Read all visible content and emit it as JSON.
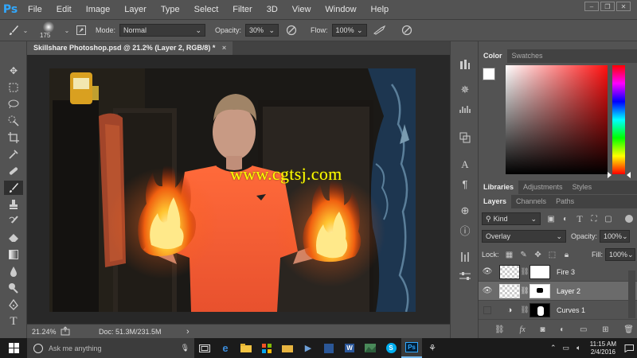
{
  "app": {
    "logo": "Ps"
  },
  "menu": [
    "File",
    "Edit",
    "Image",
    "Layer",
    "Type",
    "Select",
    "Filter",
    "3D",
    "View",
    "Window",
    "Help"
  ],
  "window_controls": {
    "minimize": "–",
    "restore": "❐",
    "close": "✕"
  },
  "options": {
    "brush_size": "175",
    "mode_label": "Mode:",
    "mode_value": "Normal",
    "opacity_label": "Opacity:",
    "opacity_value": "30%",
    "flow_label": "Flow:",
    "flow_value": "100%"
  },
  "document": {
    "tab_title": "Skillshare Photoshop.psd @ 21.2% (Layer 2, RGB/8) *",
    "close": "×",
    "watermark": "www.cgtsj.com"
  },
  "status": {
    "zoom": "21.24%",
    "doc": "Doc: 51.3M/231.5M",
    "arrow": "›"
  },
  "color_panel": {
    "tabs": [
      "Color",
      "Swatches"
    ]
  },
  "libraries_panel": {
    "tabs": [
      "Libraries",
      "Adjustments",
      "Styles"
    ]
  },
  "layers_panel": {
    "tabs": [
      "Layers",
      "Channels",
      "Paths"
    ],
    "filter_kind": "Kind",
    "blend_mode": "Overlay",
    "opacity_label": "Opacity:",
    "opacity_value": "100%",
    "lock_label": "Lock:",
    "fill_label": "Fill:",
    "fill_value": "100%",
    "layers": [
      {
        "name": "Fire 3",
        "visible": true,
        "selected": false
      },
      {
        "name": "Layer 2",
        "visible": true,
        "selected": true
      },
      {
        "name": "Curves 1",
        "visible": false,
        "selected": false
      }
    ],
    "footer_fx": "fx"
  },
  "taskbar": {
    "search_placeholder": "Ask me anything",
    "time": "11:15 AM",
    "date": "2/4/2016"
  },
  "colors": {
    "accent": "#31a8ff",
    "foreground": "#ffffff",
    "background": "#000000",
    "watermark": "#ffff00"
  }
}
